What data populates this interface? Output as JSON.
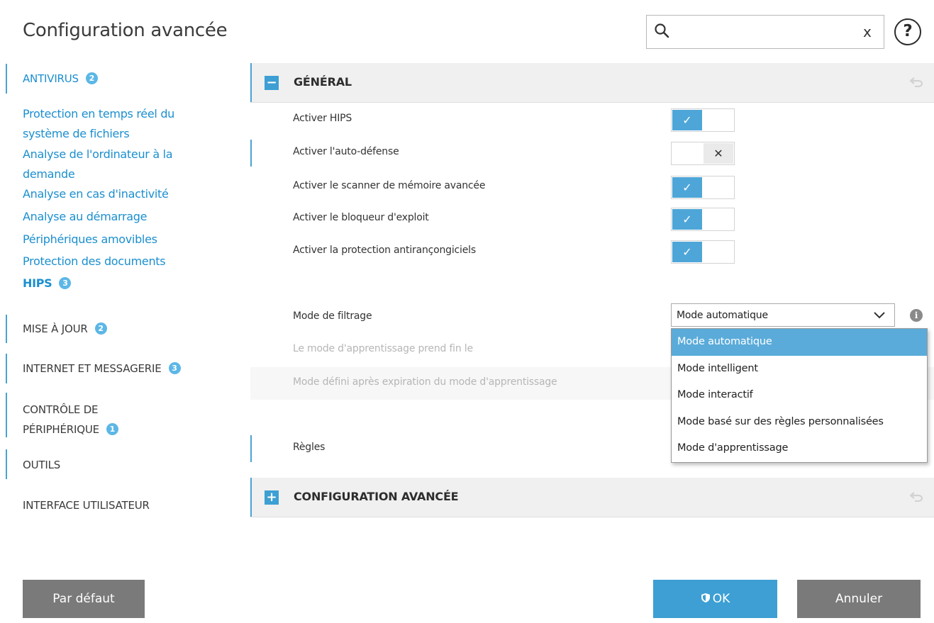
{
  "window": {
    "title": "Configuration avancée"
  },
  "search": {
    "placeholder": "",
    "clear": "x",
    "help": "?"
  },
  "sidebar": {
    "sections": [
      {
        "label": "ANTIVIRUS",
        "badge": "2"
      },
      {
        "label": "MISE À JOUR",
        "badge": "2"
      },
      {
        "label": "INTERNET ET MESSAGERIE",
        "badge": "3"
      },
      {
        "label_line1": "CONTRÔLE DE",
        "label_line2": "PÉRIPHÉRIQUE",
        "badge": "1"
      },
      {
        "label": "OUTILS"
      },
      {
        "label": "INTERFACE UTILISATEUR"
      }
    ],
    "antivirus_items": [
      "Protection en temps réel du",
      "système de fichiers",
      "Analyse de l'ordinateur à la",
      "demande",
      "Analyse en cas d'inactivité",
      "Analyse au démarrage",
      "Périphériques amovibles",
      "Protection des documents"
    ],
    "hips": {
      "label": "HIPS",
      "badge": "3"
    }
  },
  "general": {
    "header": "GÉNÉRAL",
    "toggle_icon": "−",
    "rows": [
      {
        "label": "Activer HIPS",
        "state": "on",
        "on_glyph": "✓"
      },
      {
        "label": "Activer l'auto-défense",
        "state": "off",
        "off_glyph": "✕"
      },
      {
        "label": "Activer le scanner de mémoire avancée",
        "state": "on",
        "on_glyph": "✓"
      },
      {
        "label": "Activer le bloqueur d'exploit",
        "state": "on",
        "on_glyph": "✓"
      },
      {
        "label": "Activer la protection antirançongiciels",
        "state": "on",
        "on_glyph": "✓"
      }
    ],
    "filter_mode": {
      "label": "Mode de filtrage",
      "value": "Mode automatique",
      "options": [
        "Mode automatique",
        "Mode intelligent",
        "Mode interactif",
        "Mode basé sur des règles personnalisées",
        "Mode d'apprentissage"
      ],
      "selected_index": 0
    },
    "learning_end_label": "Le mode d'apprentissage prend fin le",
    "after_learning_label": "Mode défini après expiration du mode d'apprentissage",
    "rules_label": "Règles"
  },
  "advanced": {
    "header": "CONFIGURATION AVANCÉE",
    "toggle_icon": "+"
  },
  "buttons": {
    "default": "Par défaut",
    "ok": "OK",
    "cancel": "Annuler"
  },
  "colors": {
    "accent": "#3d9fd3",
    "link": "#1b8fcf",
    "badge": "#5cb7e6",
    "button_gray": "#7a7a7a"
  }
}
